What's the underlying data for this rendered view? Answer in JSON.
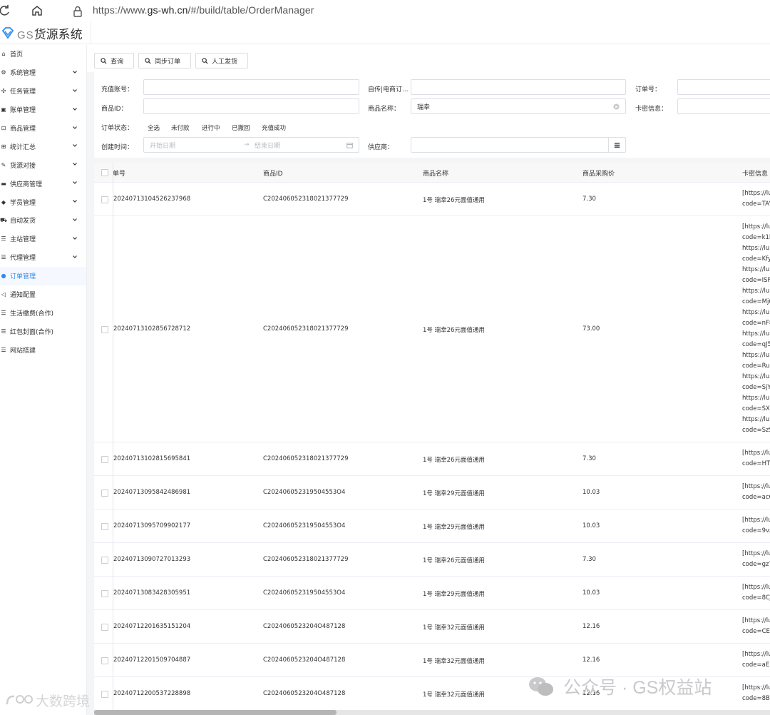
{
  "browser": {
    "url_prefix": "https://www.",
    "url_domain": "gs-wh.cn",
    "url_path": "/#/build/table/OrderManager"
  },
  "app": {
    "logo_gs": "GS",
    "logo_name": "货源系统"
  },
  "sidebar": {
    "items": [
      {
        "label": "首页",
        "icon": "home-icon",
        "chevron": false
      },
      {
        "label": "系统管理",
        "icon": "gear-icon",
        "chevron": true
      },
      {
        "label": "任务管理",
        "icon": "task-icon",
        "chevron": true
      },
      {
        "label": "账单管理",
        "icon": "bill-icon",
        "chevron": true
      },
      {
        "label": "商品管理",
        "icon": "goods-icon",
        "chevron": true
      },
      {
        "label": "统计汇总",
        "icon": "grid-icon",
        "chevron": true
      },
      {
        "label": "货源对接",
        "icon": "link-icon",
        "chevron": true
      },
      {
        "label": "供应商管理",
        "icon": "supplier-icon",
        "chevron": true
      },
      {
        "label": "学员管理",
        "icon": "student-icon",
        "chevron": true
      },
      {
        "label": "自动发货",
        "icon": "car-icon",
        "chevron": true
      },
      {
        "label": "主站管理",
        "icon": "list-icon",
        "chevron": true
      },
      {
        "label": "代理管理",
        "icon": "list-icon",
        "chevron": true
      },
      {
        "label": "订单管理",
        "icon": "dot-icon",
        "chevron": false,
        "active": true
      },
      {
        "label": "通知配置",
        "icon": "megaphone-icon",
        "chevron": false
      },
      {
        "label": "生活缴费(合作)",
        "icon": "list-icon",
        "chevron": false
      },
      {
        "label": "红包封面(合作)",
        "icon": "list-icon",
        "chevron": false
      },
      {
        "label": "网站搭建",
        "icon": "list-icon",
        "chevron": false
      }
    ]
  },
  "toolbar": {
    "query": "查询",
    "sync": "同步订单",
    "manual": "人工发货"
  },
  "filter": {
    "recharge_account": "充值账号：",
    "ecom_order": "自传|电商订...",
    "order_no": "订单号：",
    "product_id": "商品ID：",
    "product_name": "商品名称：",
    "product_name_value": "瑞幸",
    "card_info": "卡密信息：",
    "order_status": "订单状态：",
    "status_options": [
      "全选",
      "未付款",
      "进行中",
      "已撤回",
      "充值成功"
    ],
    "create_time": "创建时间：",
    "start_date": "开始日期",
    "end_date": "结束日期",
    "supplier": "供应商："
  },
  "table": {
    "headers": {
      "order_no": "单号",
      "product_id": "商品ID",
      "product_name": "商品名称",
      "price": "商品采购价",
      "card": "卡密信息"
    },
    "rows": [
      {
        "order": "20240713104526237968",
        "pid": "C202406052318021377729",
        "name": "1号 瑞幸26元面值通用",
        "price": "7.30",
        "card": [
          "[https://lu",
          "code=TAY"
        ]
      },
      {
        "order": "20240713102856728712",
        "pid": "C202406052318021377729",
        "name": "1号 瑞幸26元面值通用",
        "price": "73.00",
        "card": [
          "[https://lu",
          "code=k1b",
          "https://lu",
          "code=Kfy",
          "https://lu",
          "code=ISF",
          "https://lu",
          "code=Mj(",
          "https://lu",
          "code=nF8",
          "https://lu",
          "code=qJ5",
          "https://lu",
          "code=RuZ",
          "https://lu",
          "code=SjY",
          "https://lu",
          "code=SXI",
          "https://lu",
          "code=SzS"
        ]
      },
      {
        "order": "20240713102815695841",
        "pid": "C202406052318021377729",
        "name": "1号 瑞幸26元面值通用",
        "price": "7.30",
        "card": [
          "[https://lu",
          "code=HT("
        ]
      },
      {
        "order": "20240713095842486981",
        "pid": "C202406052319504553O4",
        "name": "1号 瑞幸29元面值通用",
        "price": "10.03",
        "card": [
          "[https://lu",
          "code=ac6"
        ]
      },
      {
        "order": "20240713095709902177",
        "pid": "C202406052319504553O4",
        "name": "1号 瑞幸29元面值通用",
        "price": "10.03",
        "card": [
          "[https://lu",
          "code=9vz"
        ]
      },
      {
        "order": "20240713090727013293",
        "pid": "C202406052318021377729",
        "name": "1号 瑞幸26元面值通用",
        "price": "7.30",
        "card": [
          "[https://lu",
          "code=gz7"
        ]
      },
      {
        "order": "20240713083428305951",
        "pid": "C202406052319504553O4",
        "name": "1号 瑞幸29元面值通用",
        "price": "10.03",
        "card": [
          "[https://lu",
          "code=8CJ"
        ]
      },
      {
        "order": "20240712201635151204",
        "pid": "C2024060523204O487128",
        "name": "1号 瑞幸32元面值通用",
        "price": "12.16",
        "card": [
          "[https://lu",
          "code=CE9"
        ]
      },
      {
        "order": "20240712201509704887",
        "pid": "C2024060523204O487128",
        "name": "1号 瑞幸32元面值通用",
        "price": "12.16",
        "card": [
          "[https://lu",
          "code=aEl"
        ]
      },
      {
        "order": "20240712200537228898",
        "pid": "C2024060523204O487128",
        "name": "1号 瑞幸32元面值通用",
        "price": "12.16",
        "card": [
          "[https://lu",
          "code=8Be"
        ]
      }
    ]
  },
  "watermarks": {
    "wechat": "公众号 · GS权益站",
    "brand": "大数跨境"
  }
}
